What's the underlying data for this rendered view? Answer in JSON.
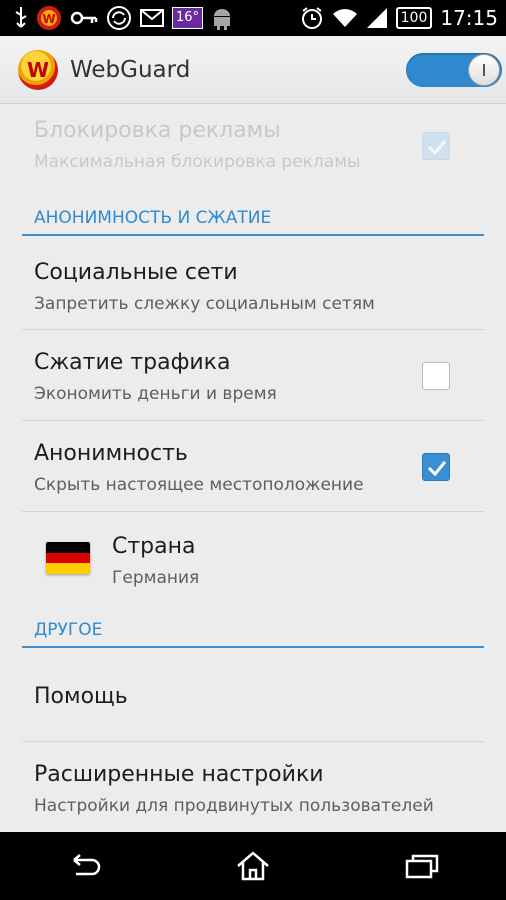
{
  "status_bar": {
    "temperature": "16°",
    "battery": "100",
    "time": "17:15",
    "icons": [
      "usb-icon",
      "webguard-icon",
      "key-icon",
      "sync-icon",
      "mail-icon",
      "weather-badge",
      "android-icon",
      "alarm-icon",
      "wifi-icon",
      "signal-icon",
      "battery-icon"
    ]
  },
  "action_bar": {
    "logo_letter": "W",
    "title": "WebGuard",
    "toggle_on": true
  },
  "colors": {
    "accent": "#2f8ad0",
    "toggle": "#2f89cf",
    "checkbox_on": "#3a8fd2",
    "flag": [
      "#000000",
      "#dd0000",
      "#ffce00"
    ]
  },
  "prefs": {
    "ad_block": {
      "title": "Блокировка рекламы",
      "summary": "Максимальная блокировка рекламы",
      "checked": true,
      "enabled": false
    },
    "section_anon": "АНОНИМНОСТЬ И СЖАТИЕ",
    "social": {
      "title": "Социальные сети",
      "summary": "Запретить слежку социальным сетям"
    },
    "compression": {
      "title": "Сжатие трафика",
      "summary": "Экономить деньги и время",
      "checked": false
    },
    "anonymity": {
      "title": "Анонимность",
      "summary": "Скрыть настоящее местоположение",
      "checked": true
    },
    "country": {
      "title": "Страна",
      "summary": "Германия",
      "flag": "germany-flag-icon"
    },
    "section_other": "ДРУГОЕ",
    "help": {
      "title": "Помощь"
    },
    "advanced": {
      "title": "Расширенные настройки",
      "summary": "Настройки для продвинутых пользователей"
    }
  },
  "nav_bar": {
    "icons": [
      "back-icon",
      "home-icon",
      "recent-apps-icon"
    ]
  }
}
